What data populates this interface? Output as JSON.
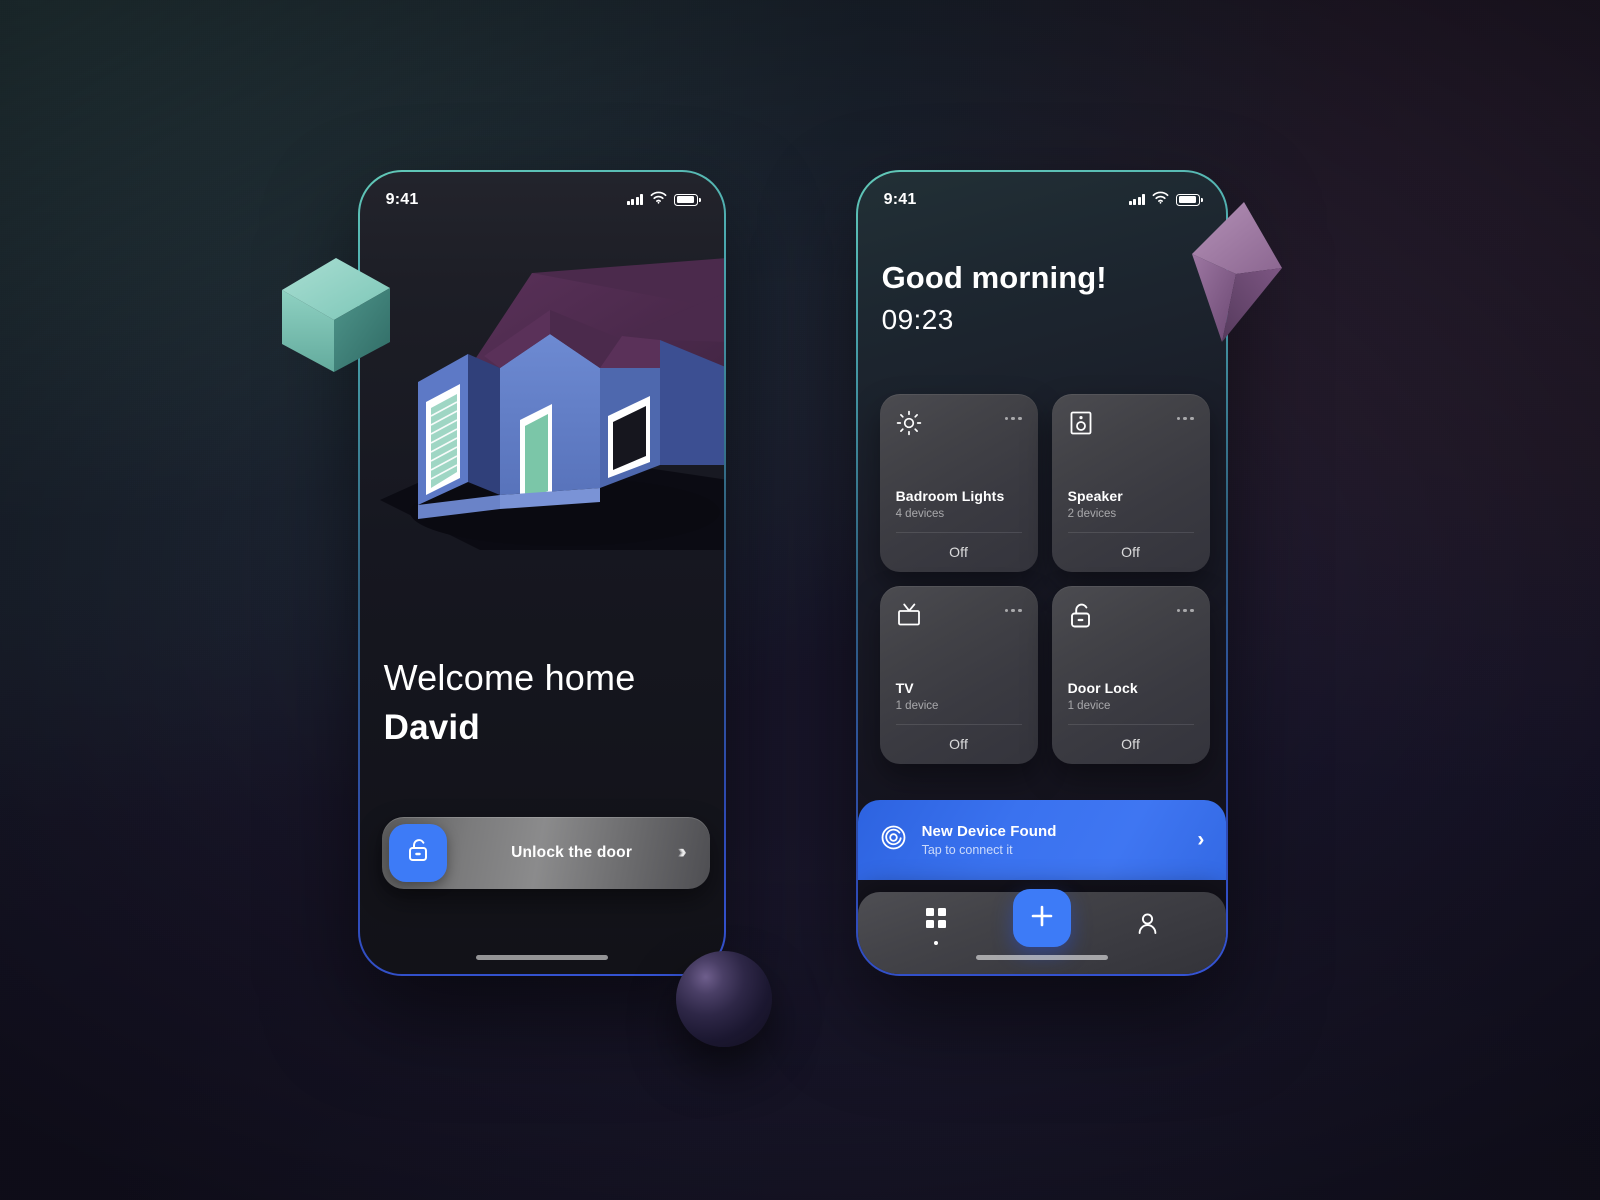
{
  "screens": {
    "left": {
      "status": {
        "time": "9:41",
        "signal_icon": "signal-bars-icon",
        "wifi_icon": "wifi-icon",
        "battery_icon": "battery-icon"
      },
      "illustration": "isometric-house-illustration",
      "greeting_line1": "Welcome home",
      "greeting_line2": "David",
      "unlock": {
        "icon": "unlock-padlock-icon",
        "label": "Unlock the door",
        "arrow1": "›",
        "arrow2": "›",
        "arrow3": "›"
      }
    },
    "right": {
      "status": {
        "time": "9:41",
        "signal_icon": "signal-bars-icon",
        "wifi_icon": "wifi-icon",
        "battery_icon": "battery-icon"
      },
      "greeting": "Good morning!",
      "clock": "09:23",
      "cards": [
        {
          "icon": "brightness-sun-icon",
          "title": "Badroom Lights",
          "subtitle": "4 devices",
          "state": "Off",
          "menu": "more-options-icon"
        },
        {
          "icon": "speaker-icon",
          "title": "Speaker",
          "subtitle": "2 devices",
          "state": "Off",
          "menu": "more-options-icon"
        },
        {
          "icon": "tv-icon",
          "title": "TV",
          "subtitle": "1 device",
          "state": "Off",
          "menu": "more-options-icon"
        },
        {
          "icon": "unlock-padlock-icon",
          "title": "Door Lock",
          "subtitle": "1 device",
          "state": "Off",
          "menu": "more-options-icon"
        }
      ],
      "banner": {
        "icon": "spiral-radar-icon",
        "title": "New Device Found",
        "subtitle": "Tap to connect it",
        "chevron": "›"
      },
      "nav": {
        "grid_icon": "grid-dashboard-icon",
        "add_icon": "plus-icon",
        "profile_icon": "person-profile-icon"
      }
    }
  },
  "decor": {
    "cube": "teal-cube-3d",
    "octahedron": "purple-octahedron-3d",
    "sphere": "dark-sphere-3d"
  },
  "colors": {
    "accent_blue": "#3d7bf7",
    "banner_blue": "#3a72ef",
    "cube_teal": "#7fcfc0",
    "octa_purple": "#9b6f9e",
    "house_wall": "#5f7fc9",
    "house_roof": "#4b2a4b",
    "house_door": "#7bc6a8",
    "card_grey": "#43434a"
  }
}
